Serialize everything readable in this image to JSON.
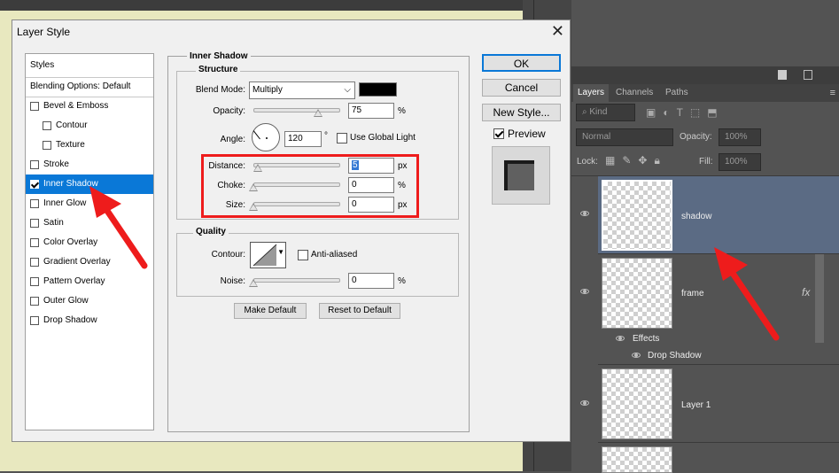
{
  "dialog": {
    "title": "Layer Style",
    "close_glyph": "✕",
    "styles_list": [
      {
        "label": "Styles",
        "type": "head"
      },
      {
        "label": "Blending Options: Default",
        "type": "head"
      },
      {
        "label": "Bevel & Emboss",
        "type": "item",
        "checked": false
      },
      {
        "label": "Contour",
        "type": "sub",
        "checked": false
      },
      {
        "label": "Texture",
        "type": "sub",
        "checked": false
      },
      {
        "label": "Stroke",
        "type": "item",
        "checked": false
      },
      {
        "label": "Inner Shadow",
        "type": "item",
        "checked": true,
        "selected": true
      },
      {
        "label": "Inner Glow",
        "type": "item",
        "checked": false
      },
      {
        "label": "Satin",
        "type": "item",
        "checked": false
      },
      {
        "label": "Color Overlay",
        "type": "item",
        "checked": false
      },
      {
        "label": "Gradient Overlay",
        "type": "item",
        "checked": false
      },
      {
        "label": "Pattern Overlay",
        "type": "item",
        "checked": false
      },
      {
        "label": "Outer Glow",
        "type": "item",
        "checked": false
      },
      {
        "label": "Drop Shadow",
        "type": "item",
        "checked": false
      }
    ],
    "section_title": "Inner Shadow",
    "structure": {
      "legend": "Structure",
      "blend_mode_label": "Blend Mode:",
      "blend_mode_value": "Multiply",
      "blend_color": "#000000",
      "opacity_label": "Opacity:",
      "opacity_value": "75",
      "opacity_unit": "%",
      "opacity_level_pct": 75,
      "angle_label": "Angle:",
      "angle_value": "120",
      "angle_unit": "°",
      "use_global_light_label": "Use Global Light",
      "use_global_light_checked": false,
      "distance_label": "Distance:",
      "distance_value": "5",
      "distance_unit": "px",
      "choke_label": "Choke:",
      "choke_value": "0",
      "choke_unit": "%",
      "size_label": "Size:",
      "size_value": "0",
      "size_unit": "px"
    },
    "quality": {
      "legend": "Quality",
      "contour_label": "Contour:",
      "anti_aliased_label": "Anti-aliased",
      "anti_aliased_checked": false,
      "noise_label": "Noise:",
      "noise_value": "0",
      "noise_unit": "%"
    },
    "make_default_label": "Make Default",
    "reset_default_label": "Reset to Default",
    "ok_label": "OK",
    "cancel_label": "Cancel",
    "new_style_label": "New Style...",
    "preview_label": "Preview",
    "preview_checked": true
  },
  "layers_panel": {
    "tabs": [
      "Layers",
      "Channels",
      "Paths"
    ],
    "active_tab": "Layers",
    "filter_label": "Kind",
    "blend_mode": "Normal",
    "opacity_label": "Opacity:",
    "opacity_value": "100%",
    "lock_label": "Lock:",
    "fill_label": "Fill:",
    "fill_value": "100%",
    "layers": [
      {
        "name": "shadow",
        "selected": true
      },
      {
        "name": "frame",
        "fx_label": "fx",
        "effects_label": "Effects",
        "effect_items": [
          "Drop Shadow"
        ]
      },
      {
        "name": "Layer 1"
      }
    ]
  },
  "colors": {
    "annotation_red": "#ee1c1c",
    "selection_blue": "#0a78d7",
    "canvas_bg": "#e8e8bf",
    "selected_layer_bg": "#5b6b84"
  }
}
